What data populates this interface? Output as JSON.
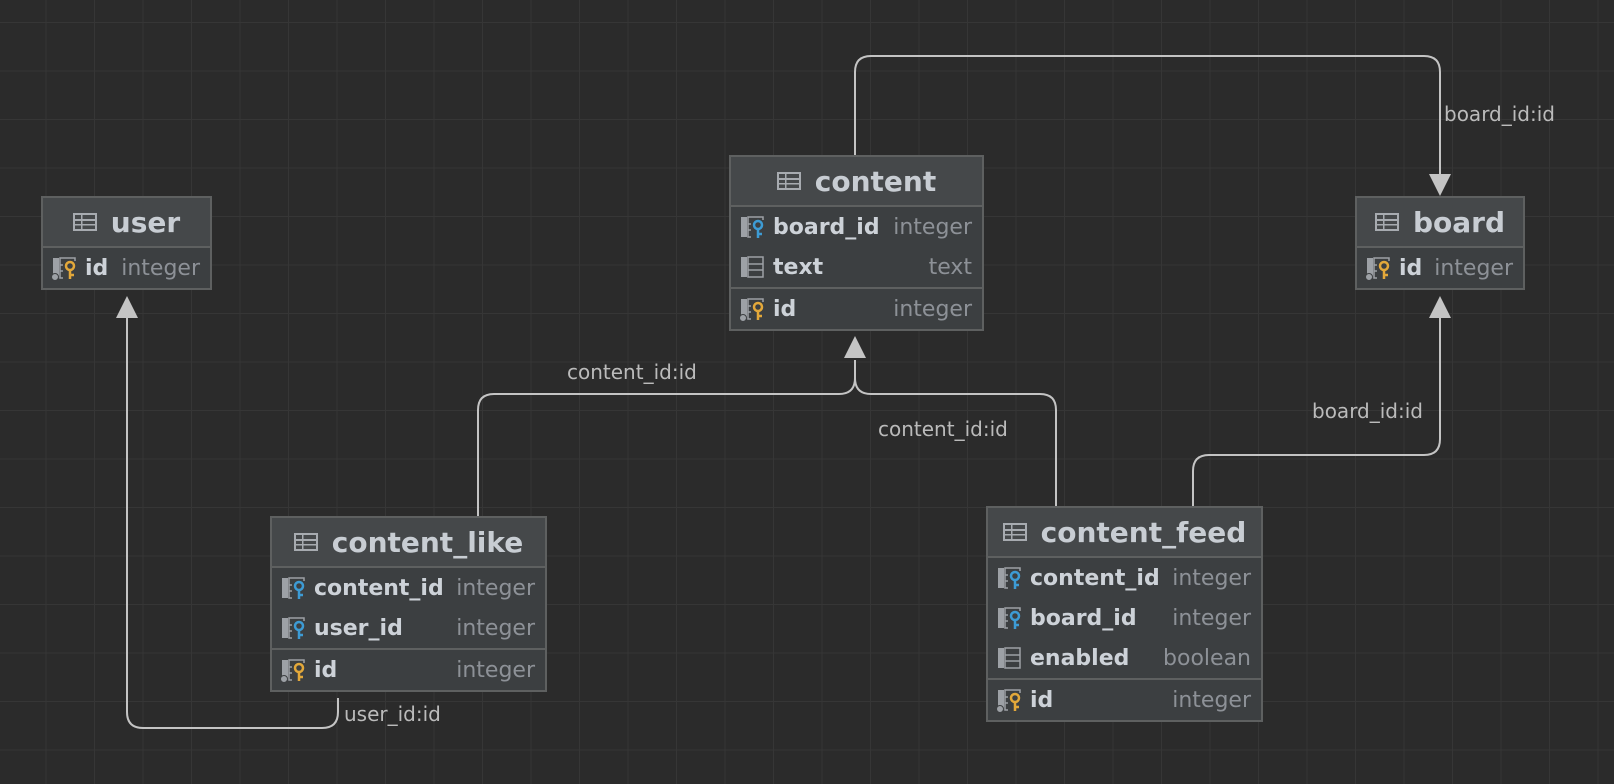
{
  "tables": {
    "user": {
      "name": "user",
      "columns": [
        {
          "name": "id",
          "type": "integer",
          "key": "pk"
        }
      ]
    },
    "content": {
      "name": "content",
      "columns": [
        {
          "name": "board_id",
          "type": "integer",
          "key": "fk"
        },
        {
          "name": "text",
          "type": "text",
          "key": "none"
        },
        {
          "name": "id",
          "type": "integer",
          "key": "pk"
        }
      ]
    },
    "board": {
      "name": "board",
      "columns": [
        {
          "name": "id",
          "type": "integer",
          "key": "pk"
        }
      ]
    },
    "content_like": {
      "name": "content_like",
      "columns": [
        {
          "name": "content_id",
          "type": "integer",
          "key": "fk"
        },
        {
          "name": "user_id",
          "type": "integer",
          "key": "fk"
        },
        {
          "name": "id",
          "type": "integer",
          "key": "pk"
        }
      ]
    },
    "content_feed": {
      "name": "content_feed",
      "columns": [
        {
          "name": "content_id",
          "type": "integer",
          "key": "fk"
        },
        {
          "name": "board_id",
          "type": "integer",
          "key": "fk"
        },
        {
          "name": "enabled",
          "type": "boolean",
          "key": "none"
        },
        {
          "name": "id",
          "type": "integer",
          "key": "pk"
        }
      ]
    }
  },
  "relations": {
    "content_board": {
      "label": "board_id:id"
    },
    "like_content": {
      "label": "content_id:id"
    },
    "feed_content": {
      "label": "content_id:id"
    },
    "feed_board": {
      "label": "board_id:id"
    },
    "like_user": {
      "label": "user_id:id"
    }
  },
  "colors": {
    "background": "#2b2b2b",
    "grid": "#363636",
    "table_body": "#3c3f41",
    "table_header": "#45484a",
    "edge": "#c4c4c4",
    "primary_key": "#e3a83a",
    "foreign_key": "#3d9bd4"
  },
  "icons": {
    "table": "table-grid-icon",
    "pk": "primary-key-icon",
    "fk": "foreign-key-icon",
    "column": "column-icon"
  }
}
